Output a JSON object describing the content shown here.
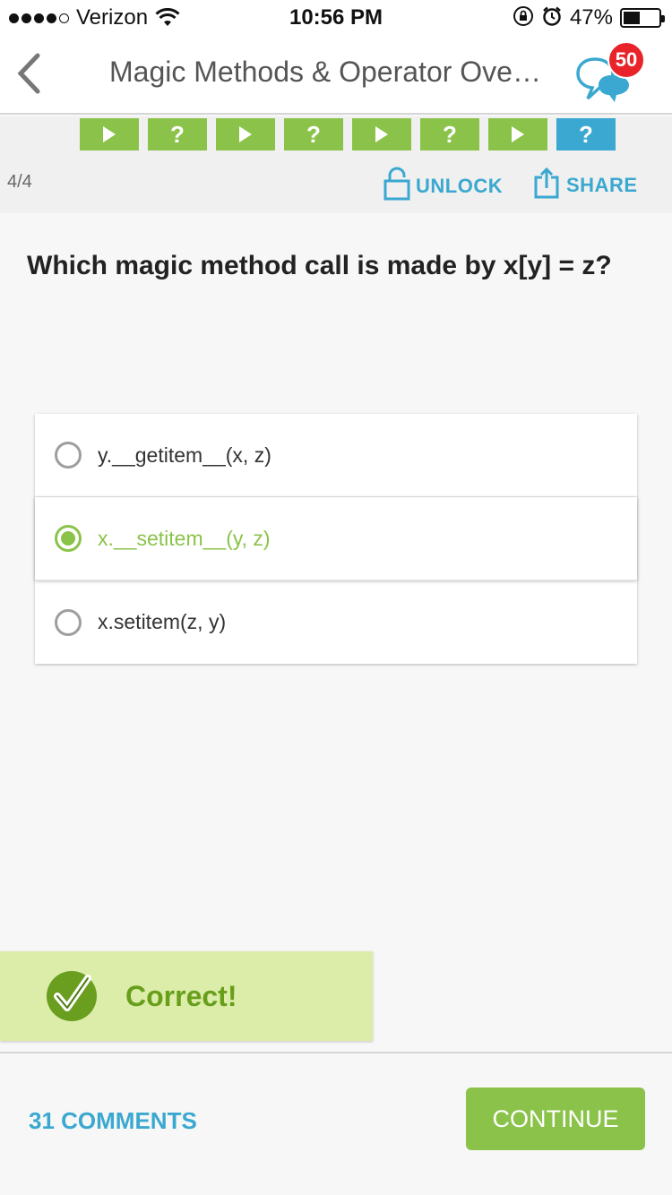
{
  "status_bar": {
    "carrier": "Verizon",
    "time": "10:56 PM",
    "battery_percent": "47%",
    "battery_level": 0.47
  },
  "nav": {
    "title": "Magic Methods & Operator Ove…",
    "chat_badge": "50"
  },
  "progress": {
    "steps": [
      {
        "type": "play"
      },
      {
        "type": "quiz",
        "label": "?"
      },
      {
        "type": "play"
      },
      {
        "type": "quiz",
        "label": "?"
      },
      {
        "type": "play"
      },
      {
        "type": "quiz",
        "label": "?"
      },
      {
        "type": "play"
      },
      {
        "type": "quiz",
        "label": "?",
        "current": true
      }
    ],
    "counter": "4/4",
    "unlock_label": "UNLOCK",
    "share_label": "SHARE"
  },
  "question": "Which magic method call is made by x[y] = z?",
  "options": [
    {
      "text": "y.__getitem__(x, z)",
      "selected": false
    },
    {
      "text": "x.__setitem__(y, z)",
      "selected": true
    },
    {
      "text": "x.setitem(z, y)",
      "selected": false
    }
  ],
  "feedback": {
    "text": "Correct!"
  },
  "footer": {
    "comments_label": "31 COMMENTS",
    "continue_label": "CONTINUE"
  },
  "colors": {
    "green": "#8bc34a",
    "blue": "#3aa8d0",
    "badge_red": "#e8232a",
    "feedback_bg": "#dcedaa"
  }
}
